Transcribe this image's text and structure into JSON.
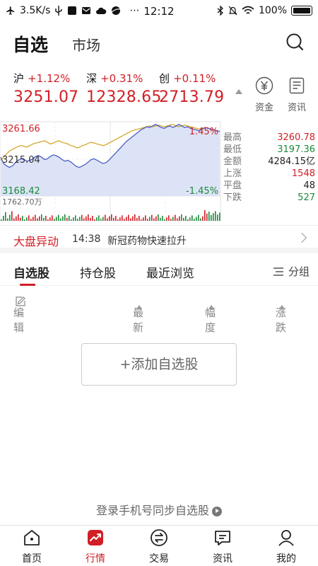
{
  "status_bar": {
    "speed": "3.5K/s",
    "time": "12:12",
    "battery": "100%"
  },
  "header": {
    "tab_watchlist": "自选",
    "tab_market": "市场"
  },
  "indices": [
    {
      "name": "沪",
      "change": "+1.12%",
      "value": "3251.07"
    },
    {
      "name": "深",
      "change": "+0.31%",
      "value": "12328.65"
    },
    {
      "name": "创",
      "change": "+0.11%",
      "value": "2713.79"
    }
  ],
  "side_buttons": {
    "funds": "资金",
    "news": "资讯"
  },
  "chart_data": {
    "type": "line",
    "y_high_label": "3261.66",
    "y_mid_label": "3215.04",
    "y_low_label": "3168.42",
    "pct_high_label": "1.45%",
    "pct_low_label": "-1.45%",
    "volume_label": "1762.70万",
    "ylim": [
      3168.42,
      3261.66
    ],
    "series": [
      {
        "values": [
          3218,
          3210,
          3207,
          3205,
          3207,
          3211,
          3214,
          3216,
          3215,
          3213,
          3214,
          3216,
          3219,
          3220,
          3218,
          3215,
          3216,
          3219,
          3221,
          3220,
          3218,
          3215,
          3213,
          3214,
          3212,
          3209,
          3206,
          3205,
          3207,
          3209,
          3212,
          3215,
          3216,
          3214,
          3212,
          3210,
          3211,
          3214,
          3218,
          3222,
          3226,
          3230,
          3234,
          3238,
          3241,
          3244,
          3247,
          3250,
          3253,
          3255,
          3257,
          3256,
          3258,
          3260,
          3258,
          3256,
          3255,
          3257,
          3258,
          3256,
          3258,
          3260,
          3258,
          3256,
          3257,
          3255,
          3254,
          3253,
          3252,
          3254,
          3256,
          3255,
          3254,
          3253,
          3252,
          3251
        ]
      },
      {
        "values": [
          3214,
          3218,
          3222,
          3226,
          3228,
          3230,
          3232,
          3233,
          3232,
          3231,
          3233,
          3235,
          3236,
          3237,
          3238,
          3239,
          3237,
          3235,
          3236,
          3238,
          3239,
          3237,
          3236,
          3235,
          3233,
          3232,
          3230,
          3231,
          3233,
          3234,
          3236,
          3237,
          3236,
          3235,
          3234,
          3233,
          3234,
          3236,
          3238,
          3240,
          3242,
          3244,
          3246,
          3248,
          3250,
          3252,
          3253,
          3254,
          3255,
          3256,
          3257,
          3258,
          3257,
          3258,
          3259,
          3258,
          3257,
          3258,
          3259,
          3260,
          3258,
          3257,
          3258,
          3259,
          3258,
          3257,
          3256,
          3255,
          3254,
          3255,
          3256,
          3255,
          3254,
          3253,
          3252,
          3251
        ]
      }
    ],
    "colors": {
      "line": "#4a5fc1",
      "area": "#dde3f7",
      "avg": "#d4a72c",
      "volume_up": "#d01f25",
      "volume_down": "#1a8a3a"
    }
  },
  "stats": [
    {
      "label": "最高",
      "value": "3260.78",
      "color": "red"
    },
    {
      "label": "最低",
      "value": "3197.36",
      "color": "green"
    },
    {
      "label": "金额",
      "value": "4284.15亿",
      "color": "black"
    },
    {
      "label": "上涨",
      "value": "1548",
      "color": "red"
    },
    {
      "label": "平盘",
      "value": "48",
      "color": "black"
    },
    {
      "label": "下跌",
      "value": "527",
      "color": "green"
    }
  ],
  "alert": {
    "title": "大盘异动",
    "time": "14:38",
    "text": "新冠药物快速拉升"
  },
  "subtabs": [
    "自选股",
    "持仓股",
    "最近浏览"
  ],
  "group_label": "分组",
  "columns": {
    "edit": "编辑",
    "latest": "最新",
    "range": "幅度",
    "change": "涨跌"
  },
  "add_button": "+添加自选股",
  "login_tip": "登录手机号同步自选股",
  "bottom_nav": [
    "首页",
    "行情",
    "交易",
    "资讯",
    "我的"
  ]
}
